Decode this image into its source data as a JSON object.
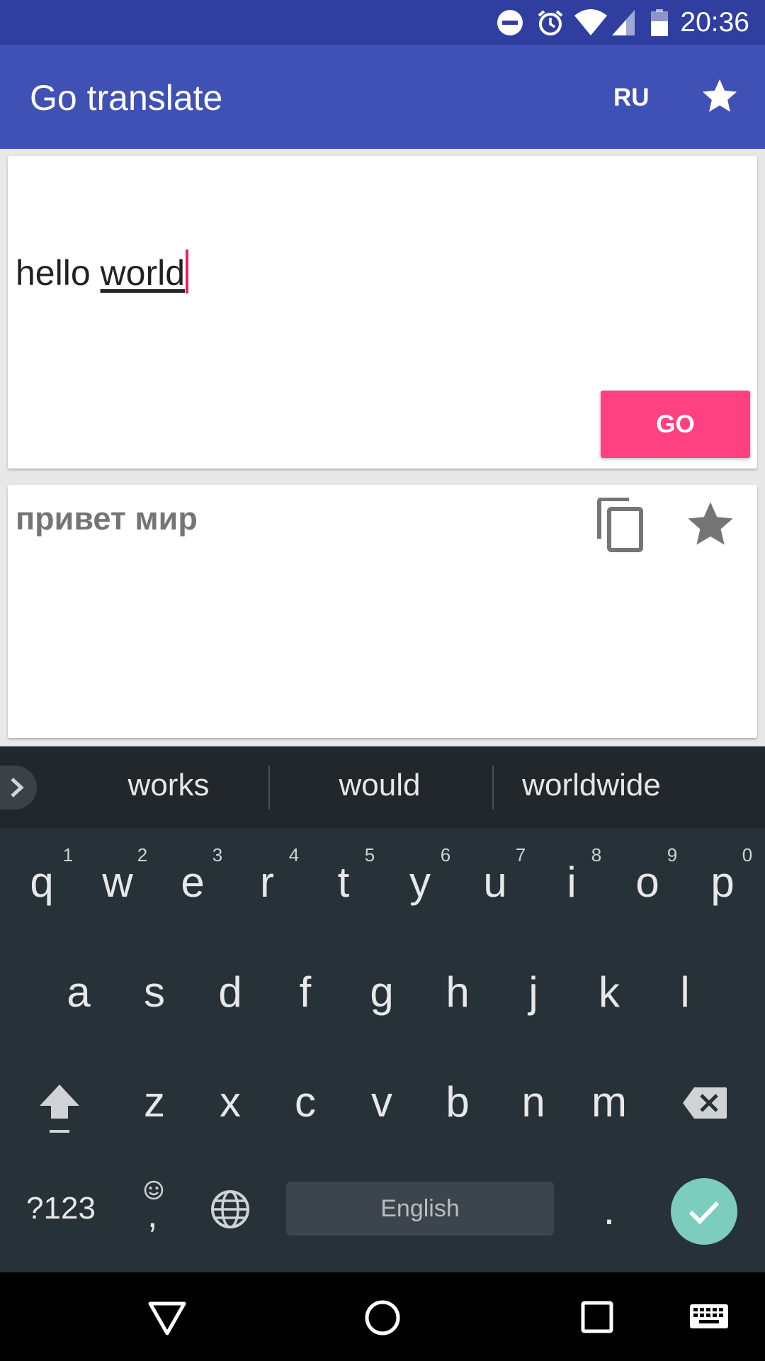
{
  "status_bar": {
    "time": "20:36",
    "icons": [
      "do-not-disturb-icon",
      "alarm-icon",
      "wifi-icon",
      "signal-icon",
      "battery-icon"
    ]
  },
  "app_bar": {
    "title": "Go translate",
    "target_language": "RU",
    "favorites_icon": "star-icon"
  },
  "input_card": {
    "text_plain": "hello ",
    "text_composing": "world",
    "go_label": "GO"
  },
  "result_card": {
    "translation": "привет мир",
    "copy_icon": "copy-icon",
    "favorite_icon": "star-icon"
  },
  "keyboard": {
    "suggestions": [
      "works",
      "would",
      "worldwide"
    ],
    "row1": [
      "q",
      "w",
      "e",
      "r",
      "t",
      "y",
      "u",
      "i",
      "o",
      "p"
    ],
    "row1_hints": [
      "1",
      "2",
      "3",
      "4",
      "5",
      "6",
      "7",
      "8",
      "9",
      "0"
    ],
    "row2": [
      "a",
      "s",
      "d",
      "f",
      "g",
      "h",
      "j",
      "k",
      "l"
    ],
    "row3": [
      "z",
      "x",
      "c",
      "v",
      "b",
      "n",
      "m"
    ],
    "symbols_label": "?123",
    "comma": ",",
    "period": ".",
    "space_label": "English"
  },
  "colors": {
    "status_bar": "#303f9f",
    "primary": "#3f51b5",
    "accent": "#ff4081",
    "keyboard_bg": "#263238",
    "enter_key": "#7ccdbd"
  }
}
